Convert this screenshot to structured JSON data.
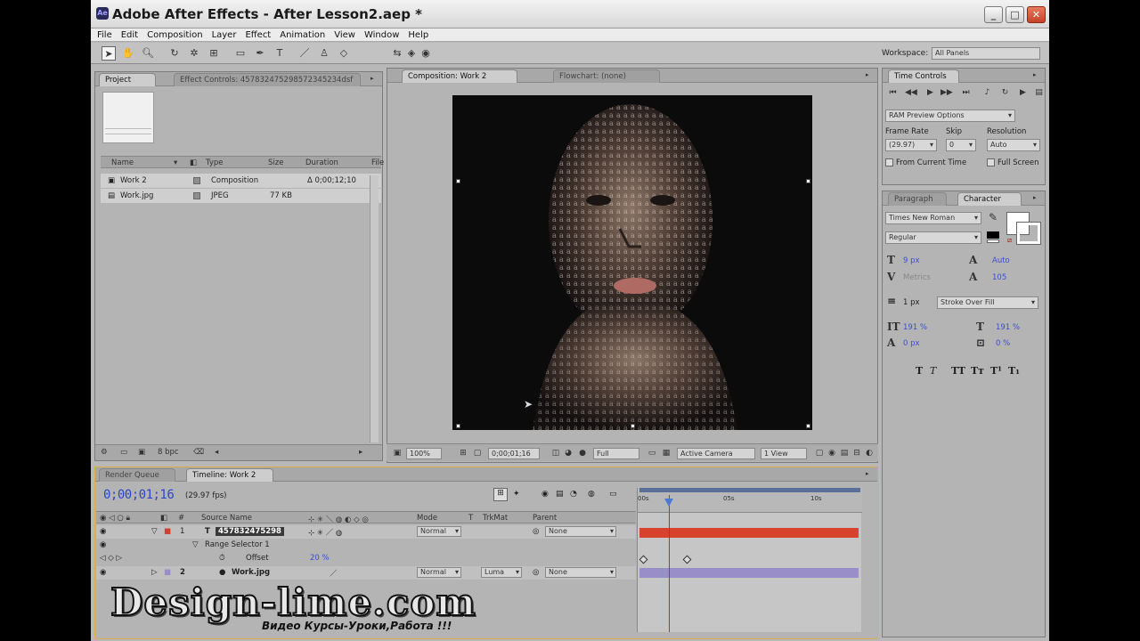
{
  "window": {
    "title": "Adobe After Effects - After Lesson2.aep *",
    "app_icon": "Ae"
  },
  "menu": [
    "File",
    "Edit",
    "Composition",
    "Layer",
    "Effect",
    "Animation",
    "View",
    "Window",
    "Help"
  ],
  "workspace": {
    "label": "Workspace:",
    "value": "All Panels"
  },
  "project_panel": {
    "tab_project": "Project",
    "tab_effect_controls": "Effect Controls: 457832475298572345234dsf",
    "columns": {
      "name": "Name",
      "type": "Type",
      "size": "Size",
      "duration": "Duration",
      "file": "File"
    },
    "items": [
      {
        "name": "Work 2",
        "type": "Composition",
        "size": "",
        "duration": "Δ 0;00;12;10"
      },
      {
        "name": "Work.jpg",
        "type": "JPEG",
        "size": "77 KB",
        "duration": ""
      }
    ],
    "bpc": "8 bpc"
  },
  "composition_panel": {
    "tab_composition": "Composition: Work 2",
    "tab_flowchart": "Flowchart: (none)",
    "zoom": "100%",
    "timecode": "0;00;01;16",
    "resolution": "Full",
    "camera": "Active Camera",
    "views": "1 View"
  },
  "time_controls": {
    "tab": "Time Controls",
    "ram_preview": "RAM Preview Options",
    "frame_rate_label": "Frame Rate",
    "skip_label": "Skip",
    "resolution_label": "Resolution",
    "frame_rate": "(29.97)",
    "skip": "0",
    "resolution": "Auto",
    "from_current": "From Current Time",
    "full_screen": "Full Screen"
  },
  "character_panel": {
    "tab_paragraph": "Paragraph",
    "tab_character": "Character",
    "font": "Times New Roman",
    "style": "Regular",
    "font_size": "9 px",
    "leading": "Auto",
    "kerning": "Metrics",
    "tracking": "105",
    "stroke_width": "1 px",
    "stroke_type": "Stroke Over Fill",
    "vscale": "191 %",
    "hscale": "191 %",
    "baseline": "0 px",
    "tsume": "0 %"
  },
  "timeline": {
    "tab_render": "Render Queue",
    "tab_timeline": "Timeline: Work 2",
    "current_time": "0;00;01;16",
    "fps": "(29.97 fps)",
    "columns": {
      "source_name": "Source Name",
      "mode": "Mode",
      "t": "T",
      "trkmat": "TrkMat",
      "parent": "Parent"
    },
    "layers": [
      {
        "index": "1",
        "name": "457832475298",
        "mode": "Normal",
        "trkmat": "",
        "parent": "None"
      },
      {
        "index": "2",
        "name": "Work.jpg",
        "mode": "Normal",
        "trkmat": "Luma",
        "parent": "None"
      }
    ],
    "range_selector": "Range Selector 1",
    "offset_label": "Offset",
    "offset_value": "20 %",
    "ruler": [
      "00s",
      "05s",
      "10s"
    ]
  },
  "watermark": {
    "main": "Design-lime.com",
    "sub": "Видео Курсы-Уроки,Работа !!!"
  }
}
